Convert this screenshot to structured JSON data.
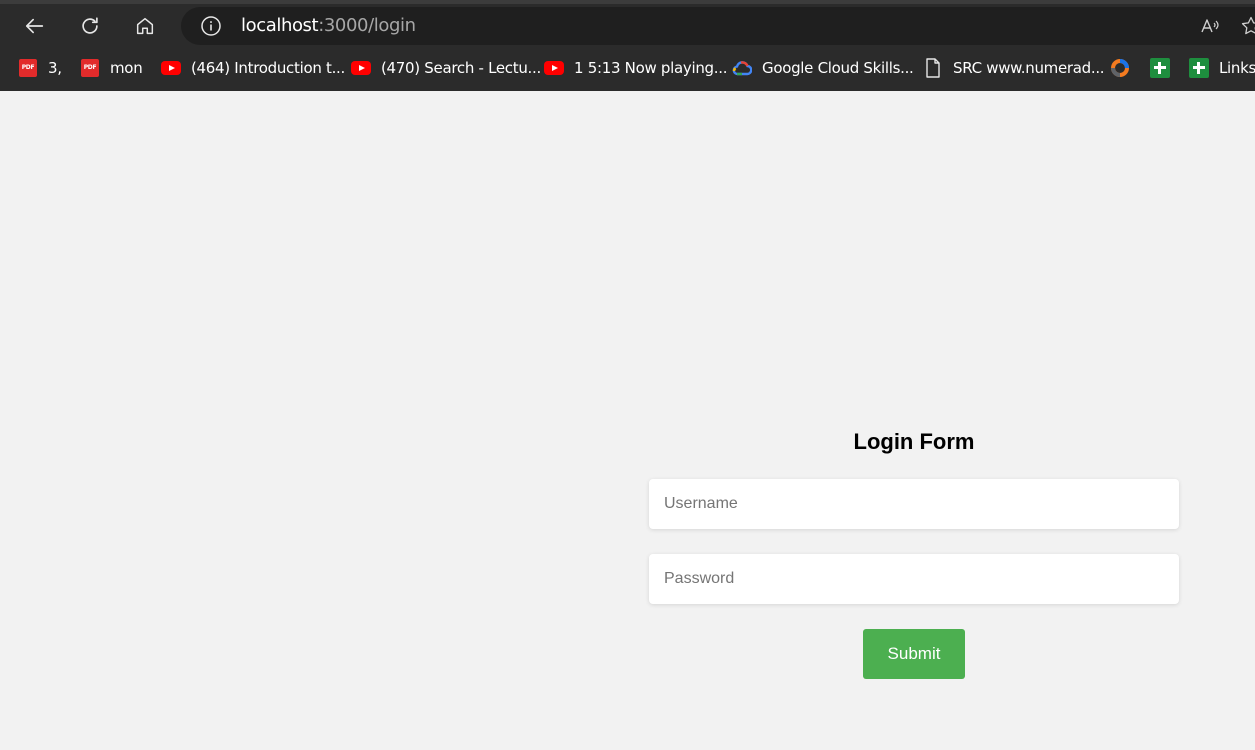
{
  "browser": {
    "url_host": "localhost",
    "url_path": ":3000/login",
    "bookmarks": [
      {
        "label": "3,",
        "icon": "pdf-icon",
        "icon_text": "PDF"
      },
      {
        "label": "mon",
        "icon": "pdf-icon",
        "icon_text": "PDF"
      },
      {
        "label": "(464) Introduction t...",
        "icon": "youtube-icon"
      },
      {
        "label": "(470) Search - Lectu...",
        "icon": "youtube-icon"
      },
      {
        "label": "1 5:13 Now playing...",
        "icon": "youtube-icon"
      },
      {
        "label": "Google Cloud Skills...",
        "icon": "google-cloud-icon"
      },
      {
        "label": "SRC www.numerad...",
        "icon": "document-icon"
      },
      {
        "label": "",
        "icon": "colorful-circle-icon"
      },
      {
        "label": "",
        "icon": "google-sheets-icon"
      },
      {
        "label": "Links",
        "icon": "google-sheets-icon"
      }
    ]
  },
  "login": {
    "title": "Login Form",
    "username_placeholder": "Username",
    "password_placeholder": "Password",
    "submit_label": "Submit"
  },
  "colors": {
    "page_background": "#f2f2f2",
    "chrome_background": "#2b2b2b",
    "submit_button": "#4caf50"
  }
}
